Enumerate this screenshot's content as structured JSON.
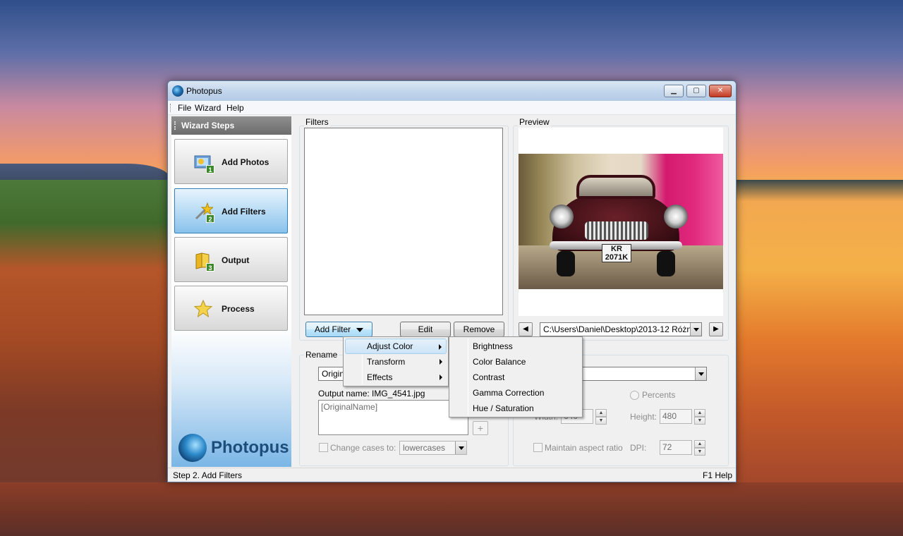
{
  "window": {
    "title": "Photopus",
    "minimize": "▁",
    "maximize": "▢",
    "close": "✕"
  },
  "menu": {
    "items": [
      {
        "label": "File"
      },
      {
        "label": "Wizard"
      },
      {
        "label": "Help"
      }
    ]
  },
  "sidebar": {
    "header": "Wizard Steps",
    "steps": [
      {
        "label": "Add Photos",
        "badge": "1",
        "icon": "photos-icon",
        "active": false
      },
      {
        "label": "Add Filters",
        "badge": "2",
        "icon": "magic-wand-icon",
        "active": true
      },
      {
        "label": "Output",
        "badge": "3",
        "icon": "folder-icon",
        "active": false
      },
      {
        "label": "Process",
        "badge": "",
        "icon": "star-icon",
        "active": false
      }
    ],
    "logo_text": "Photopus"
  },
  "filters": {
    "group_title": "Filters",
    "add_filter_label": "Add Filter",
    "edit_label": "Edit",
    "remove_label": "Remove"
  },
  "preview": {
    "group_title": "Preview",
    "path": "C:\\Users\\Daniel\\Desktop\\2013-12 Różne\\",
    "prev_label": "◀",
    "next_label": "▶",
    "plate_line1": "KR",
    "plate_line2": "2071K"
  },
  "rename": {
    "group_title": "Rename",
    "mode_value": "Origina",
    "output_name_label": "Output name: IMG_4541.jpg",
    "pattern_value": "[OriginalName]",
    "insert_button": "+",
    "change_cases_label": "Change cases to:",
    "case_value": "lowercases"
  },
  "resize": {
    "percents_label": "Percents",
    "width_label": "Width:",
    "width_value": "640",
    "height_label": "Height:",
    "height_value": "480",
    "maintain_aspect_label": "Maintain aspect ratio",
    "dpi_label": "DPI:",
    "dpi_value": "72",
    "spin_up": "▲",
    "spin_down": "▼"
  },
  "add_filter_menu": {
    "items": [
      {
        "label": "Adjust Color",
        "has_submenu": true,
        "highlighted": true
      },
      {
        "label": "Transform",
        "has_submenu": true,
        "highlighted": false
      },
      {
        "label": "Effects",
        "has_submenu": true,
        "highlighted": false
      }
    ]
  },
  "adjust_color_submenu": {
    "items": [
      {
        "label": "Brightness"
      },
      {
        "label": "Color Balance"
      },
      {
        "label": "Contrast"
      },
      {
        "label": "Gamma Correction"
      },
      {
        "label": "Hue / Saturation"
      }
    ]
  },
  "status": {
    "left": "Step 2. Add Filters",
    "right": "F1 Help"
  }
}
